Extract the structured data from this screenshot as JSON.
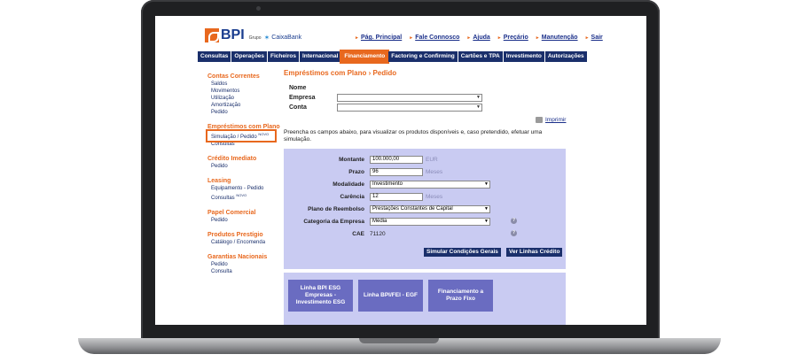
{
  "header": {
    "logo_text": "BPI",
    "logo_grupo": "Grupo",
    "logo_caixa": "CaixaBank",
    "top_links": [
      "Pág. Principal",
      "Fale Connosco",
      "Ajuda",
      "Preçário",
      "Manutenção",
      "Sair"
    ]
  },
  "nav": {
    "tabs": [
      {
        "label": "Consultas"
      },
      {
        "label": "Operações"
      },
      {
        "label": "Ficheiros"
      },
      {
        "label": "Internacional"
      },
      {
        "label": "Financiamento"
      },
      {
        "label": "Factoring e Confirming"
      },
      {
        "label": "Cartões e TPA"
      },
      {
        "label": "Investimento"
      },
      {
        "label": "Autorizações"
      }
    ],
    "active_tab": "Financiamento"
  },
  "sidebar": {
    "sections": [
      {
        "title": "Contas Correntes",
        "items": [
          "Saldos",
          "Movimentos",
          "Utilização",
          "Amortização",
          "Pedido"
        ]
      },
      {
        "title": "Empréstimos com Plano",
        "items": [
          "Simulação / Pedido",
          "Consultas"
        ],
        "badge": "NOVO"
      },
      {
        "title": "Crédito Imediato",
        "items": [
          "Pedido"
        ]
      },
      {
        "title": "Leasing",
        "items": [
          "Equipamento - Pedido",
          "Consultas"
        ],
        "badge2": "NOVO"
      },
      {
        "title": "Papel Comercial",
        "items": [
          "Pedido"
        ]
      },
      {
        "title": "Produtos Prestígio",
        "items": [
          "Catálogo / Encomenda"
        ]
      },
      {
        "title": "Garantias Nacionais",
        "items": [
          "Pedido",
          "Consulta"
        ]
      }
    ]
  },
  "main": {
    "title": "Empréstimos com Plano › Pedido",
    "nome_label": "Nome",
    "empresa_label": "Empresa",
    "conta_label": "Conta",
    "empresa_value": "",
    "conta_value": "",
    "print_label": "Imprimir",
    "intro": "Preencha os campos abaixo, para visualizar os produtos disponíveis e, caso pretendido, efetuar uma simulação."
  },
  "simulation": {
    "montante_label": "Montante",
    "montante_value": "100.000,00",
    "montante_unit": "EUR",
    "prazo_label": "Prazo",
    "prazo_value": "96",
    "prazo_unit": "Meses",
    "modalidade_label": "Modalidade",
    "modalidade_value": "Investimento",
    "carencia_label": "Carência",
    "carencia_value": "12",
    "carencia_unit": "Meses",
    "plano_label": "Plano de Reembolso",
    "plano_value": "Prestações Constantes de Capital",
    "categoria_label": "Categoria da Empresa",
    "categoria_value": "Média",
    "cae_label": "CAE",
    "cae_value": "71120",
    "simular_button": "Simular Condições Gerais",
    "ver_linhas_button": "Ver Linhas Crédito"
  },
  "credit_lines": [
    "Linha BPI ESG Empresas - Investimento ESG",
    "Linha BPI/FEI - EGF",
    "Financiamento a Prazo Fixo"
  ],
  "colors": {
    "brand_orange": "#e8681e",
    "nav_blue": "#1a2f6b",
    "panel_lavender": "#c9cbf2",
    "line_button": "#6a6cc1"
  }
}
